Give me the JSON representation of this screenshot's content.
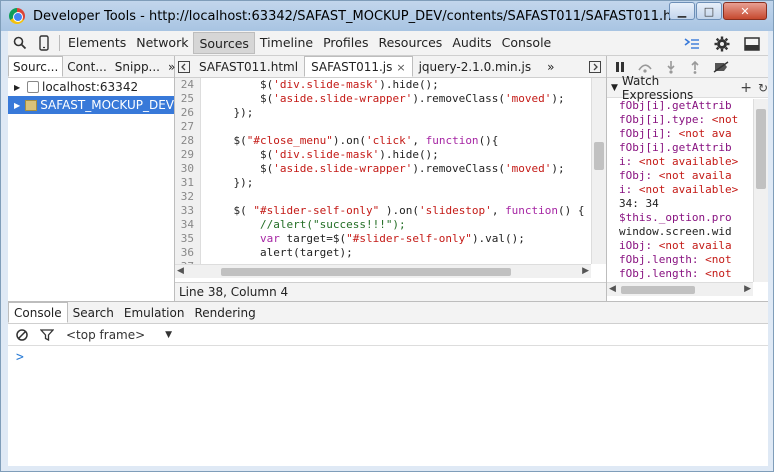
{
  "window": {
    "title": "Developer Tools - http://localhost:63342/SAFAST_MOCKUP_DEV/contents/SAFAST011/SAFAST011.html",
    "controls": [
      "minimize",
      "maximize",
      "close"
    ]
  },
  "mainbar": {
    "tabs": [
      {
        "label": "Elements",
        "active": false
      },
      {
        "label": "Network",
        "active": false
      },
      {
        "label": "Sources",
        "active": true
      },
      {
        "label": "Timeline",
        "active": false
      },
      {
        "label": "Profiles",
        "active": false
      },
      {
        "label": "Resources",
        "active": false
      },
      {
        "label": "Audits",
        "active": false
      },
      {
        "label": "Console",
        "active": false
      }
    ]
  },
  "navigator": {
    "tabs": [
      "Sourc...",
      "Cont...",
      "Snipp...",
      "»"
    ],
    "tree": [
      {
        "label": "localhost:63342",
        "selected": false
      },
      {
        "label": "SAFAST_MOCKUP_DEV",
        "selected": true
      }
    ]
  },
  "editor": {
    "tabs": [
      {
        "label": "SAFAST011.html",
        "active": false
      },
      {
        "label": "SAFAST011.js",
        "active": true
      },
      {
        "label": "jquery-2.1.0.min.js",
        "active": false
      }
    ],
    "more": "»",
    "status": "Line 38, Column 4",
    "lines": [
      {
        "n": "24",
        "t": "        $('div.slide-mask').hide();"
      },
      {
        "n": "25",
        "t": "        $('aside.slide-wrapper').removeClass('moved');"
      },
      {
        "n": "26",
        "t": "    });"
      },
      {
        "n": "27",
        "t": ""
      },
      {
        "n": "28",
        "t": "    $(\"#close_menu\").on('click', function(){"
      },
      {
        "n": "29",
        "t": "        $('div.slide-mask').hide();"
      },
      {
        "n": "30",
        "t": "        $('aside.slide-wrapper').removeClass('moved');"
      },
      {
        "n": "31",
        "t": "    });"
      },
      {
        "n": "32",
        "t": ""
      },
      {
        "n": "33",
        "t": "    $( \"#slider-self-only\" ).on('slidestop', function() {"
      },
      {
        "n": "34",
        "t": "        //alert(\"success!!!\");"
      },
      {
        "n": "35",
        "t": "        var target=$(\"#slider-self-only\").val();"
      },
      {
        "n": "36",
        "t": "        alert(target);"
      },
      {
        "n": "37",
        "t": ""
      }
    ]
  },
  "sidebar": {
    "watch_label": "Watch Expressions",
    "watch": [
      {
        "k": "fObj[i].getAttrib",
        "v": "",
        "style": "key"
      },
      {
        "k": "fObj[i].type: ",
        "v": "<not",
        "style": "na"
      },
      {
        "k": "fObj[i]: ",
        "v": "<not ava",
        "style": "na"
      },
      {
        "k": "fObj[i].getAttrib",
        "v": "",
        "style": "key"
      },
      {
        "k": "i: ",
        "v": "<not available>",
        "style": "na"
      },
      {
        "k": "fObj: ",
        "v": "<not availa",
        "style": "na"
      },
      {
        "k": "i: ",
        "v": "<not available>",
        "style": "na"
      },
      {
        "k": "34: 34",
        "v": "",
        "style": "plain"
      },
      {
        "k": "$this._option.pro",
        "v": "",
        "style": "key"
      },
      {
        "k": "window.screen.wid",
        "v": "",
        "style": "plain"
      },
      {
        "k": "iObj: ",
        "v": "<not availa",
        "style": "na"
      },
      {
        "k": "fObj.length: ",
        "v": "<not",
        "style": "na"
      },
      {
        "k": "fObj.length: ",
        "v": "<not",
        "style": "na"
      }
    ]
  },
  "drawer": {
    "tabs": [
      {
        "label": "Console",
        "active": true
      },
      {
        "label": "Search",
        "active": false
      },
      {
        "label": "Emulation",
        "active": false
      },
      {
        "label": "Rendering",
        "active": false
      }
    ],
    "frame_select": "<top frame>",
    "prompt": ">"
  }
}
